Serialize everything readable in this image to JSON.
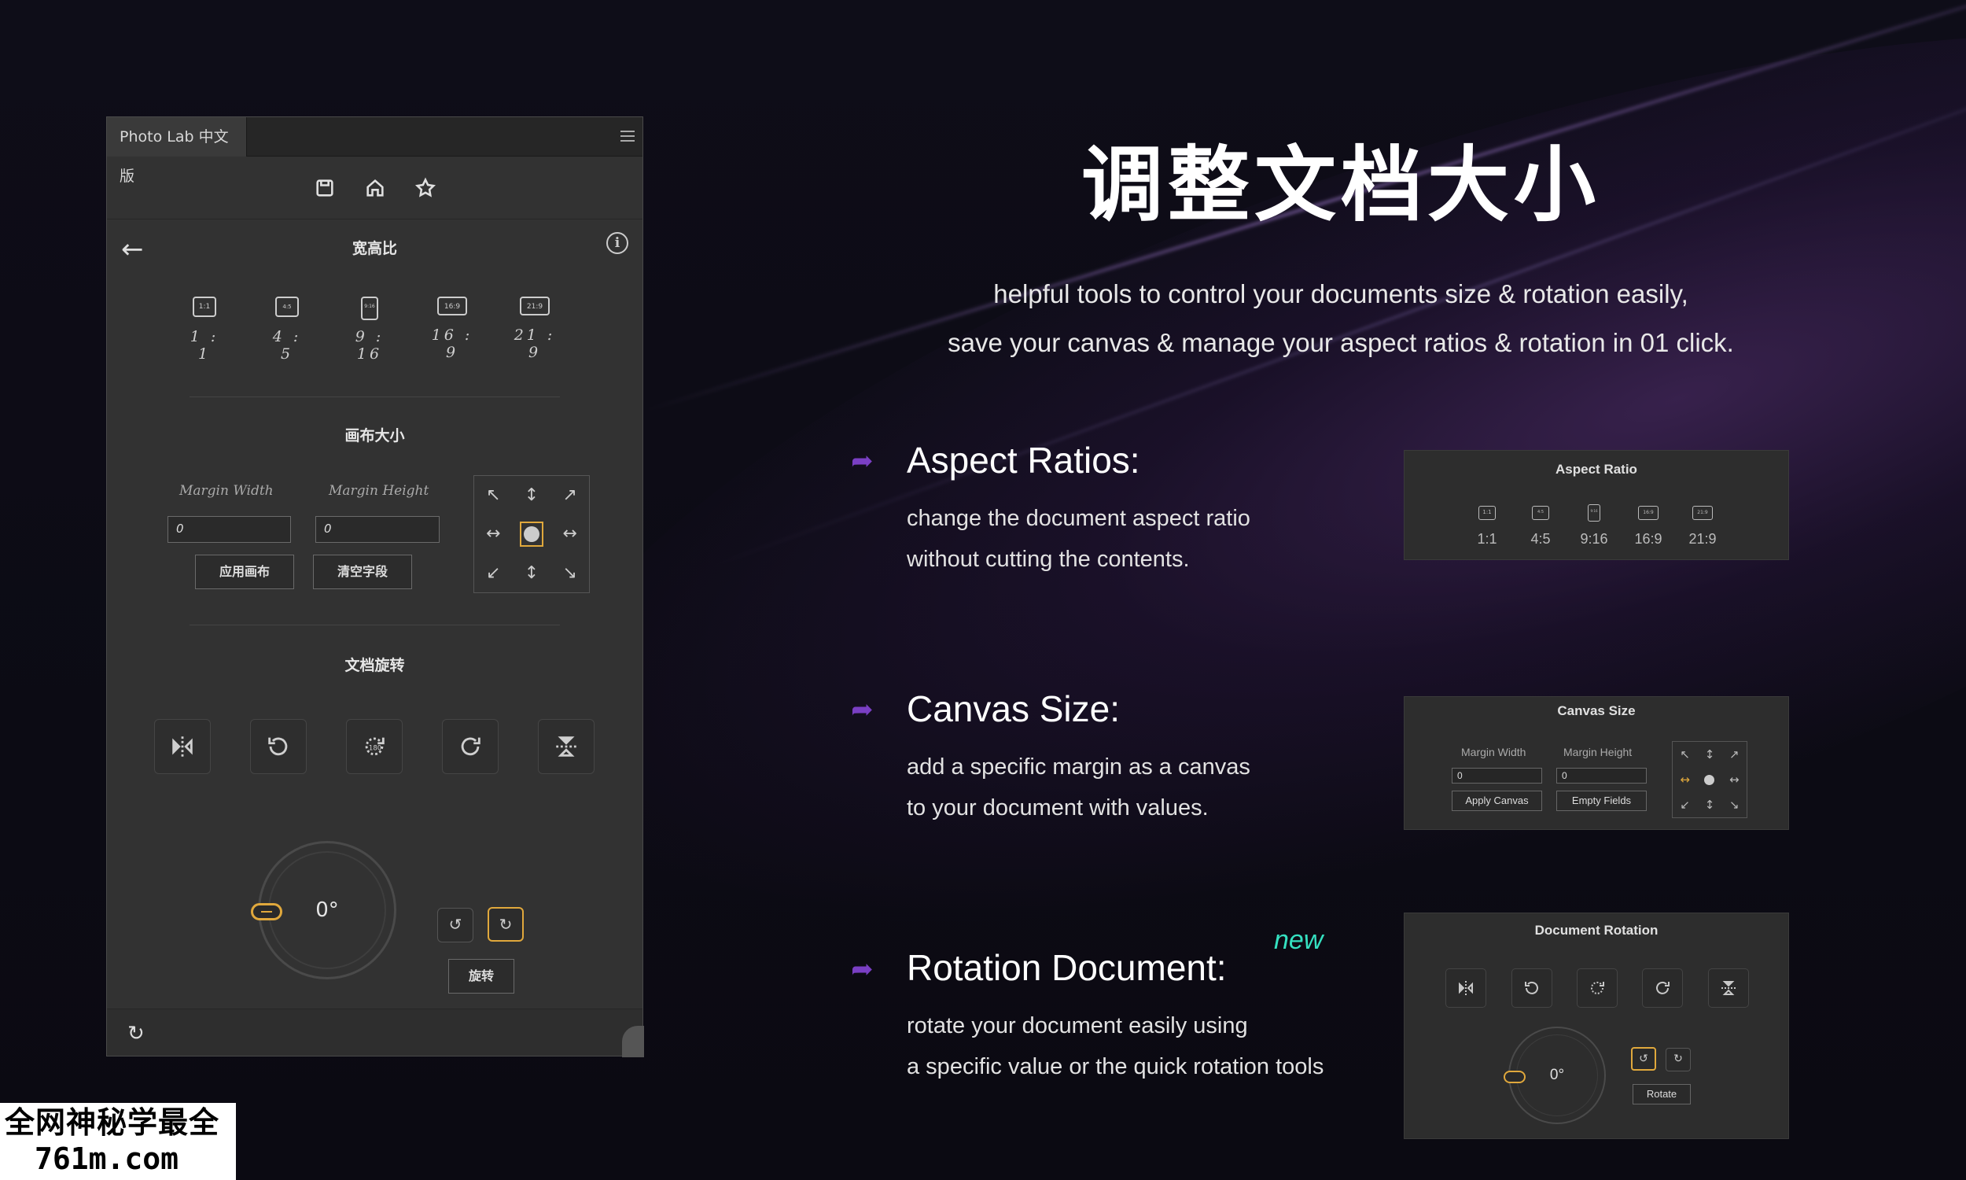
{
  "panel": {
    "tab_title": "Photo Lab 中文版",
    "aspect_title": "宽高比",
    "ratios": [
      {
        "icon": "1:1",
        "label": "1 : 1"
      },
      {
        "icon": "4:5",
        "label": "4 : 5"
      },
      {
        "icon": "9:16",
        "label": "9 : 16"
      },
      {
        "icon": "16:9",
        "label": "16 : 9"
      },
      {
        "icon": "21:9",
        "label": "21 : 9"
      }
    ],
    "canvas_title": "画布大小",
    "margin_width_label": "Margin Width",
    "margin_height_label": "Margin Height",
    "margin_width_value": "0",
    "margin_height_value": "0",
    "apply_canvas": "应用画布",
    "empty_fields": "清空字段",
    "rotation_title": "文档旋转",
    "dial_value": "0°",
    "rotate_button": "旋转"
  },
  "right": {
    "heading": "调整文档大小",
    "sub1": "helpful tools to control your documents size & rotation easily,",
    "sub2": "save your canvas & manage your aspect ratios & rotation in 01 click.",
    "features": [
      {
        "title": "Aspect Ratios:",
        "desc1": "change the document aspect ratio",
        "desc2": "without cutting the contents."
      },
      {
        "title": "Canvas Size:",
        "desc1": "add a specific margin as a canvas",
        "desc2": "to your document with values."
      },
      {
        "title": "Rotation Document:",
        "desc1": "rotate your document easily using",
        "desc2": "a specific value or the quick rotation tools"
      }
    ],
    "new_tag": "new"
  },
  "cards": {
    "aspect": {
      "title": "Aspect Ratio",
      "ratios": [
        {
          "icon": "1:1",
          "label": "1:1"
        },
        {
          "icon": "4:5",
          "label": "4:5"
        },
        {
          "icon": "9:16",
          "label": "9:16"
        },
        {
          "icon": "16:9",
          "label": "16:9"
        },
        {
          "icon": "21:9",
          "label": "21:9"
        }
      ]
    },
    "canvas": {
      "title": "Canvas Size",
      "margin_width_label": "Margin Width",
      "margin_height_label": "Margin Height",
      "margin_width_value": "0",
      "margin_height_value": "0",
      "apply_canvas": "Apply Canvas",
      "empty_fields": "Empty Fields"
    },
    "rotation": {
      "title": "Document Rotation",
      "dial_value": "0°",
      "rotate_button": "Rotate"
    }
  },
  "watermark": {
    "line1": "全网神秘学最全",
    "line2": "761m.com"
  },
  "colors": {
    "accent_orange": "#e0a83c",
    "accent_purple": "#7a3fc4",
    "new_teal": "#35e0c0"
  },
  "icons": {
    "toolbar": [
      "save-icon",
      "home-icon",
      "star-icon"
    ],
    "rotation": [
      "flip-horizontal-icon",
      "rotate-ccw-icon",
      "rotate-180-icon",
      "rotate-cw-icon",
      "flip-vertical-icon"
    ]
  }
}
